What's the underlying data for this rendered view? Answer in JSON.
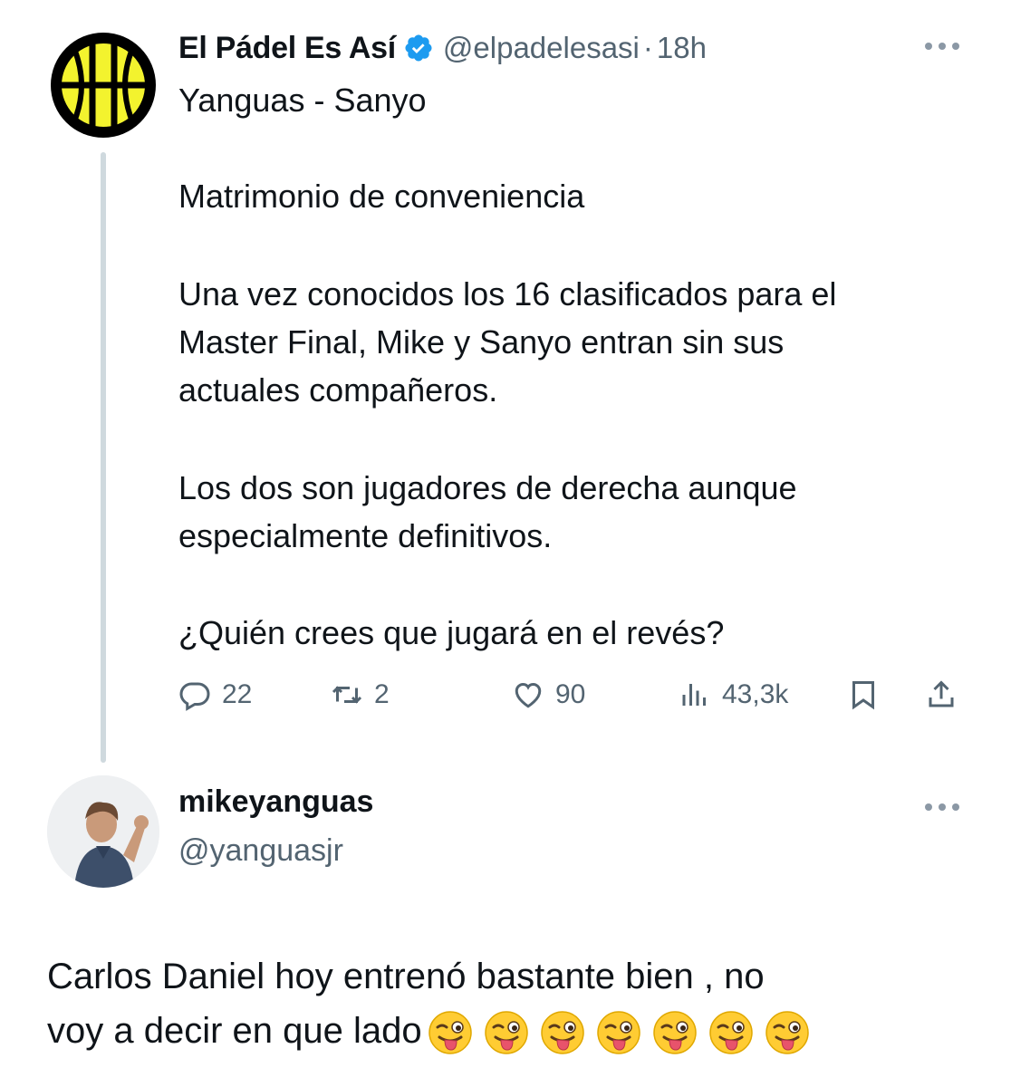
{
  "tweet": {
    "author_name": "El Pádel Es Así",
    "handle": "@elpadelesasi",
    "separator": "·",
    "time": "18h",
    "lines": [
      "Yanguas - Sanyo",
      "Matrimonio de conveniencia",
      "Una vez conocidos los 16 clasificados para el\nMaster Final, Mike y Sanyo entran sin sus\nactuales compañeros.",
      "Los dos son jugadores de derecha aunque\nespecialmente definitivos.",
      "¿Quién crees que jugará en el revés?"
    ],
    "stats": {
      "replies": "22",
      "reposts": "2",
      "likes": "90",
      "views": "43,3k"
    }
  },
  "reply": {
    "author_name": "mikeyanguas",
    "handle": "@yanguasjr",
    "text_line1": "Carlos Daniel hoy entrenó bastante bien , no",
    "text_line2": "voy a decir en que lado",
    "emoji_count": 7
  },
  "colors": {
    "text": "#0f1419",
    "secondary": "#536471",
    "verified": "#1d9bf0",
    "thread_line": "#cfd9de",
    "logo_yellow": "#f3f32e"
  },
  "icons": {
    "verified": "verified-badge-icon",
    "more": "more-options-icon",
    "reply": "reply-icon",
    "repost": "repost-icon",
    "like": "heart-icon",
    "views": "views-chart-icon",
    "bookmark": "bookmark-icon",
    "share": "share-icon",
    "emoji": "winking-face-with-tongue-emoji"
  }
}
